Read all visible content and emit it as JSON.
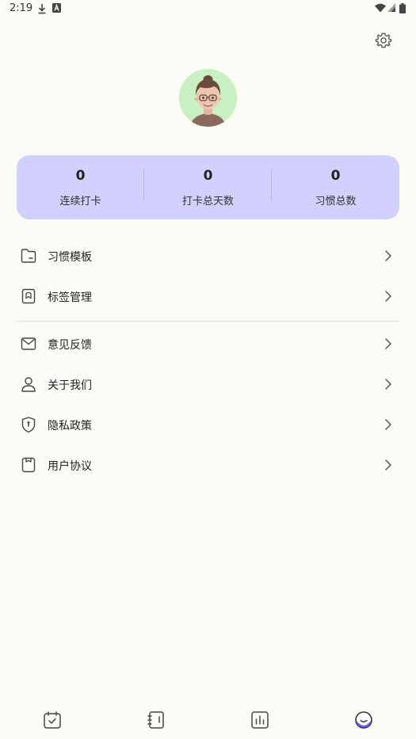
{
  "status_bar": {
    "time": "2:19",
    "icons": [
      "download-icon",
      "a-badge-icon",
      "wifi-icon",
      "cellular-signal-icon",
      "battery-icon"
    ]
  },
  "header": {
    "settings_icon": "gear-icon"
  },
  "profile": {
    "avatar_background": "#c8f0c2"
  },
  "stats": {
    "background": "#d2d0fd",
    "items": [
      {
        "value": "0",
        "label": "连续打卡"
      },
      {
        "value": "0",
        "label": "打卡总天数"
      },
      {
        "value": "0",
        "label": "习惯总数"
      }
    ]
  },
  "menu": {
    "groups": [
      [
        {
          "icon": "folder-icon",
          "label": "习惯模板"
        },
        {
          "icon": "bookmark-tag-icon",
          "label": "标签管理"
        }
      ],
      [
        {
          "icon": "mail-icon",
          "label": "意见反馈"
        },
        {
          "icon": "person-icon",
          "label": "关于我们"
        },
        {
          "icon": "shield-icon",
          "label": "隐私政策"
        },
        {
          "icon": "document-icon",
          "label": "用户协议"
        }
      ]
    ]
  },
  "bottom_nav": {
    "items": [
      {
        "icon": "calendar-check-icon",
        "active": false
      },
      {
        "icon": "notebook-icon",
        "active": false
      },
      {
        "icon": "bar-chart-icon",
        "active": false
      },
      {
        "icon": "smiley-profile-icon",
        "active": true
      }
    ],
    "accent": "#6a5ce8"
  }
}
